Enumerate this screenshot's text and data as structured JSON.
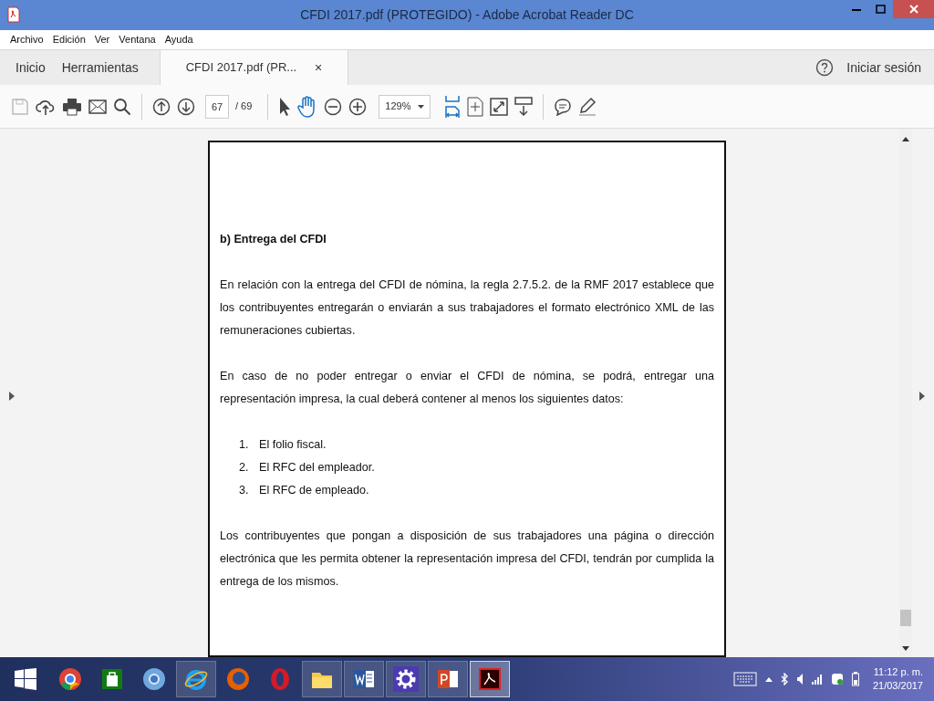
{
  "window": {
    "title": "CFDI 2017.pdf (PROTEGIDO) - Adobe Acrobat Reader DC"
  },
  "menu": [
    "Archivo",
    "Edición",
    "Ver",
    "Ventana",
    "Ayuda"
  ],
  "nav_tabs": [
    {
      "label": "Inicio",
      "selected": false
    },
    {
      "label": "Herramientas",
      "selected": false
    }
  ],
  "doc_tab": {
    "label": "CFDI 2017.pdf (PR...",
    "close": "×",
    "selected": true
  },
  "sign_in": "Iniciar sesión",
  "toolbar": {
    "page": "67",
    "page_total": "/ 69",
    "zoom": "129%",
    "tools": [
      {
        "kind": "select",
        "selected": false
      },
      {
        "kind": "hand",
        "selected": true
      }
    ]
  },
  "document": {
    "heading": "b) Entrega del CFDI",
    "paragraphs": [
      "En relación con la entrega del CFDI de nómina, la regla 2.7.5.2. de la RMF 2017 establece que los contribuyentes entregarán o enviarán a sus trabajadores el formato electrónico XML de las remuneraciones cubiertas.",
      "En caso de no poder entregar o enviar el CFDI de nómina, se podrá, entregar una representación impresa, la cual deberá contener al menos los siguientes datos:"
    ],
    "list": [
      {
        "number": "1.",
        "text": "El folio fiscal."
      },
      {
        "number": "2.",
        "text": "El RFC del empleador."
      },
      {
        "number": "3.",
        "text": "El RFC de empleado."
      }
    ],
    "closing": "Los contribuyentes que pongan a disposición de sus trabajadores una página o dirección electrónica que les permita obtener la representación impresa del CFDI, tendrán por cumplida la entrega de los mismos."
  },
  "taskbar": {
    "apps": [
      {
        "kind": "chrome",
        "running": false,
        "selected": false
      },
      {
        "kind": "store",
        "running": false,
        "selected": false
      },
      {
        "kind": "chromium",
        "running": false,
        "selected": false
      },
      {
        "kind": "ie",
        "running": true,
        "selected": false
      },
      {
        "kind": "firefox",
        "running": false,
        "selected": false
      },
      {
        "kind": "opera",
        "running": false,
        "selected": false
      },
      {
        "kind": "explorer",
        "running": true,
        "selected": false
      },
      {
        "kind": "word",
        "running": true,
        "selected": false
      },
      {
        "kind": "settings",
        "running": true,
        "selected": false
      },
      {
        "kind": "powerpoint",
        "running": true,
        "selected": false
      },
      {
        "kind": "acrobat",
        "running": true,
        "selected": true
      }
    ],
    "time": "11:12 p. m.",
    "date": "21/03/2017"
  }
}
